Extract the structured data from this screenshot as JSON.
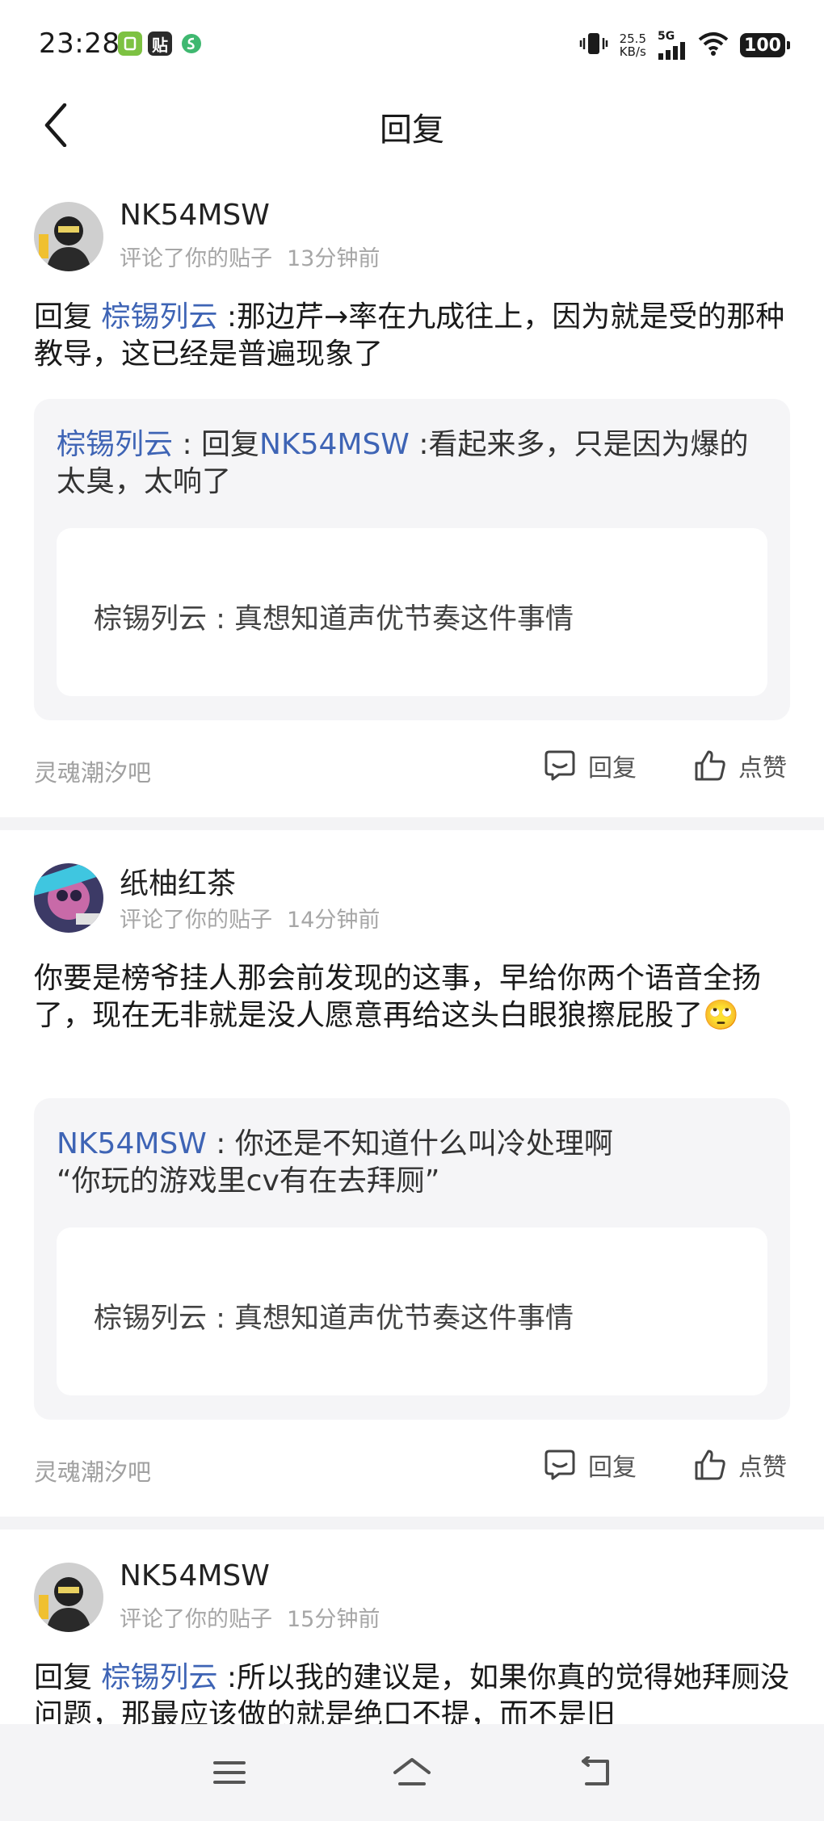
{
  "status_bar": {
    "time": "23:28",
    "app_icons": [
      {
        "name": "green-app-icon",
        "glyph": "▢",
        "color": "#7dc242"
      },
      {
        "name": "tieba-app-icon",
        "glyph": "贴",
        "color": "#2b2b2b"
      },
      {
        "name": "green-s-app-icon",
        "glyph": "S",
        "color": "#3fb870"
      }
    ],
    "net_speed_value": "25.5",
    "net_speed_unit": "KB/s",
    "network": "5G",
    "battery": "100"
  },
  "header": {
    "title": "回复"
  },
  "notifications": [
    {
      "username": "NK54MSW",
      "action_text": "评论了你的贴子",
      "time": "13分钟前",
      "reply_prefix": "回复",
      "reply_to": "棕锡列云",
      "content": " :那边芹→率在九成往上，因为就是受的那种教导，这已经是普遍现象了",
      "quote_author": "棕锡列云",
      "quote_sep": " : ",
      "quote_reply_prefix": "回复",
      "quote_reply_to": "NK54MSW",
      "quote_content": " :看起来多，只是因为爆的太臭，太响了",
      "inner_text": "棕锡列云 : 真想知道声优节奏这件事情",
      "bar_name": "灵魂潮汐吧",
      "reply_label": "回复",
      "like_label": "点赞"
    },
    {
      "username": "纸柚红茶",
      "action_text": "评论了你的贴子",
      "time": "14分钟前",
      "content": "你要是榜爷挂人那会前发现的这事，早给你两个语音全扬了，现在无非就是没人愿意再给这头白眼狼擦屁股了🙄",
      "quote_author": "NK54MSW",
      "quote_sep": " : ",
      "quote_content": "你还是不知道什么叫冷处理啊\n“你玩的游戏里cv有在去拜厕”",
      "inner_text": "棕锡列云 : 真想知道声优节奏这件事情",
      "bar_name": "灵魂潮汐吧",
      "reply_label": "回复",
      "like_label": "点赞"
    },
    {
      "username": "NK54MSW",
      "action_text": "评论了你的贴子",
      "time": "15分钟前",
      "reply_prefix": "回复",
      "reply_to": "棕锡列云",
      "content": " :所以我的建议是，如果你真的觉得她拜厕没问题，那最应该做的就是绝口不提，而不是旧"
    }
  ],
  "colors": {
    "link": "#3e64b5",
    "meta_gray": "#a6a6a6",
    "quote_bg": "#f5f5f7",
    "separator": "#f3f3f5"
  },
  "bottom_nav": {
    "items": [
      "menu-icon",
      "home-icon",
      "back-nav-icon"
    ]
  }
}
